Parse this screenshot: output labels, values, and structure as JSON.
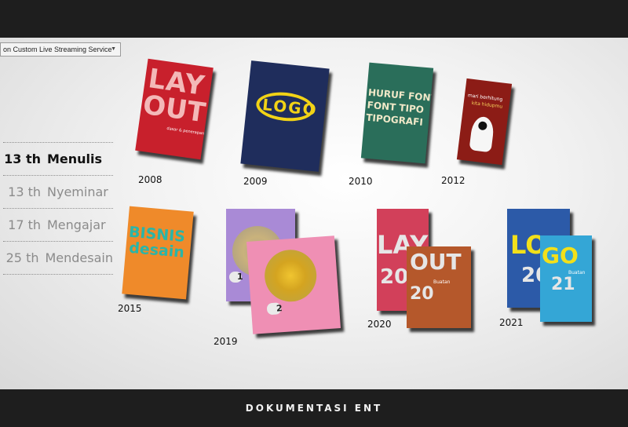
{
  "window": {
    "dropdown_label": "on Custom Live Streaming Service",
    "footer": "DOKUMENTASI ENT"
  },
  "stats": [
    {
      "number": "13 th",
      "label": "Menulis",
      "active": true
    },
    {
      "number": "13 th",
      "label": "Nyeminar",
      "active": false
    },
    {
      "number": "17 th",
      "label": "Mengajar",
      "active": false
    },
    {
      "number": "25 th",
      "label": "Mendesain",
      "active": false
    }
  ],
  "books": [
    {
      "year": "2008",
      "color": "#c8202c",
      "lines": [
        "LAY",
        "OUT"
      ],
      "subtitle": "dasar & penerapannya"
    },
    {
      "year": "2009",
      "color": "#1f2d5c",
      "lines": [
        "LOGO"
      ]
    },
    {
      "year": "2010",
      "color": "#2a6e5a",
      "lines": [
        "HURUF FONT",
        "FONT TIPO",
        "TIPOGRAFI"
      ]
    },
    {
      "year": "2012",
      "color": "#8c1c16",
      "lines": [
        "mari berhitung",
        "kita hidupmu"
      ]
    },
    {
      "year": "2015",
      "color": "#ef8a2a",
      "lines": [
        "BISNIS",
        "desain"
      ]
    },
    {
      "year": "2019",
      "color": "#a98ad6",
      "lines": [
        "1",
        "2"
      ],
      "second_color": "#ef8fb4"
    },
    {
      "year": "2020",
      "color": "#d2405a",
      "lines": [
        "LAY",
        "20",
        "OUT",
        "20"
      ],
      "second_color": "#b5582b",
      "subtitle": "Buatan"
    },
    {
      "year": "2021",
      "color": "#2c5aa8",
      "lines": [
        "LO",
        "20",
        "GO",
        "21"
      ],
      "second_color": "#34a6d6",
      "subtitle": "Buatan"
    }
  ],
  "icons": {
    "dropdown": "chevron-down-icon"
  }
}
